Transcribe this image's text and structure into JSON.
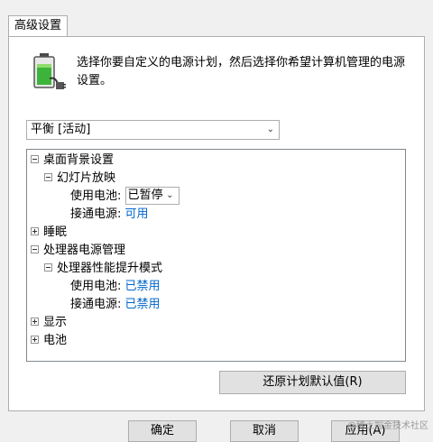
{
  "tab": {
    "label": "高级设置"
  },
  "description": "选择你要自定义的电源计划，然后选择你希望计算机管理的电源设置。",
  "scheme_select": {
    "value": "平衡 [活动]"
  },
  "tree": {
    "desktop_background": "桌面背景设置",
    "slideshow": "幻灯片放映",
    "slideshow_battery_label": "使用电池:",
    "slideshow_battery_value": "已暂停",
    "slideshow_plugged_label": "接通电源:",
    "slideshow_plugged_value": "可用",
    "sleep": "睡眠",
    "processor_power": "处理器电源管理",
    "boost_mode": "处理器性能提升模式",
    "boost_battery_label": "使用电池:",
    "boost_battery_value": "已禁用",
    "boost_plugged_label": "接通电源:",
    "boost_plugged_value": "已禁用",
    "display": "显示",
    "battery": "电池"
  },
  "restore_button": "还原计划默认值(R)",
  "bottom_buttons": {
    "ok": "确定",
    "cancel": "取消",
    "apply": "应用(A)"
  },
  "watermark": "@稀土掘金技术社区",
  "icons": {
    "battery": "battery-plug-icon"
  }
}
